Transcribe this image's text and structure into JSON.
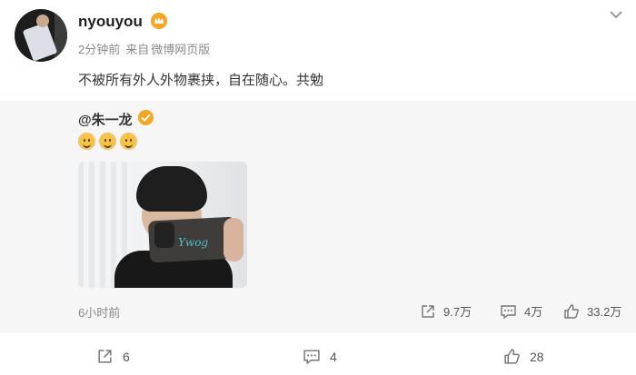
{
  "post": {
    "username": "nyouyou",
    "time": "2分钟前",
    "source_prefix": "来自",
    "source": "微博网页版",
    "text": "不被所有外人外物裹挟，自在随心。共勉"
  },
  "retweet": {
    "author": "@朱一龙",
    "time": "6小时前",
    "emoji_icon": "smile-emoji-icon",
    "photo_scribble": "Ywog",
    "stats": {
      "repost": "9.7万",
      "comment": "4万",
      "like": "33.2万"
    }
  },
  "actions": {
    "repost": "6",
    "comment": "4",
    "like": "28"
  },
  "colors": {
    "badge": "#f5a623",
    "quote_bg": "#f6f6f6",
    "meta": "#8a8a8a"
  }
}
